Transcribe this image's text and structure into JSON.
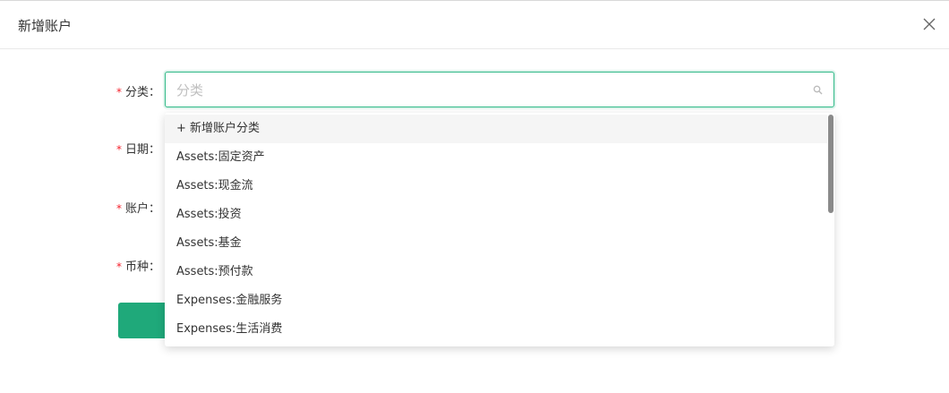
{
  "dialog": {
    "title": "新增账户"
  },
  "form": {
    "fields": [
      {
        "required_mark": "*",
        "label": "分类："
      },
      {
        "required_mark": "*",
        "label": "日期："
      },
      {
        "required_mark": "*",
        "label": "账户："
      },
      {
        "required_mark": "*",
        "label": "币种："
      }
    ],
    "category_select": {
      "placeholder": "分类",
      "value": ""
    }
  },
  "dropdown": {
    "options": [
      "+ 新增账户分类",
      "Assets:固定资产",
      "Assets:现金流",
      "Assets:投资",
      "Assets:基金",
      "Assets:预付款",
      "Expenses:金融服务",
      "Expenses:生活消费"
    ],
    "active_index": 0
  },
  "colors": {
    "accent": "#2eb886",
    "button": "#1fa97a",
    "required": "#f5222d"
  }
}
